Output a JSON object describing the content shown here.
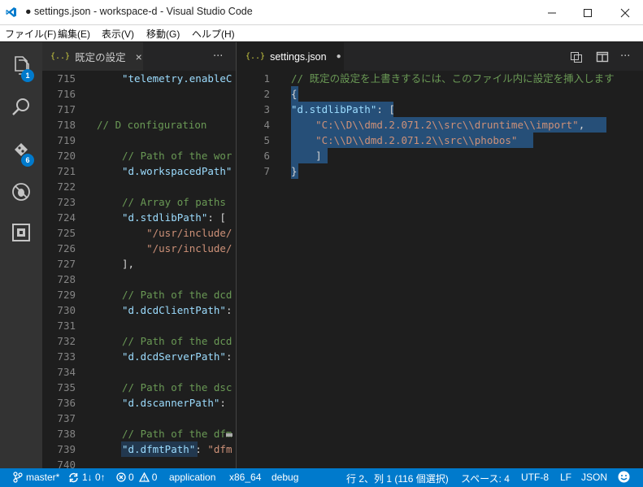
{
  "window": {
    "title": "● settings.json - workspace-d - Visual Studio Code",
    "controls": [
      "minimize-icon",
      "maximize-icon",
      "close-icon"
    ]
  },
  "menu": [
    "ファイル(F)",
    "編集(E)",
    "表示(V)",
    "移動(G)",
    "ヘルプ(H)"
  ],
  "activity": {
    "items": [
      "explorer-icon",
      "search-icon",
      "source-control-icon",
      "debug-icon",
      "extensions-icon"
    ],
    "badges": {
      "explorer": "1",
      "scm": "6"
    }
  },
  "left_editor": {
    "tab": {
      "icon": "{..}",
      "label": "既定の設定",
      "close": "×"
    },
    "more": "···",
    "lines": [
      {
        "n": "715",
        "parts": [
          [
            "k",
            "\"telemetry.enableC"
          ]
        ]
      },
      {
        "n": "716",
        "parts": []
      },
      {
        "n": "717",
        "parts": []
      },
      {
        "n": "718",
        "parts": [
          [
            "c",
            "// D configuration"
          ]
        ]
      },
      {
        "n": "719",
        "parts": []
      },
      {
        "n": "720",
        "parts": [
          [
            "c",
            "// Path of the wor"
          ]
        ]
      },
      {
        "n": "721",
        "parts": [
          [
            "k",
            "\"d.workspacedPath\""
          ]
        ]
      },
      {
        "n": "722",
        "parts": []
      },
      {
        "n": "723",
        "parts": [
          [
            "c",
            "// Array of paths "
          ]
        ]
      },
      {
        "n": "724",
        "parts": [
          [
            "k",
            "\"d.stdlibPath\""
          ],
          [
            "p",
            ": ["
          ]
        ]
      },
      {
        "n": "725",
        "parts": [
          [
            "s",
            "    \"/usr/include/"
          ]
        ]
      },
      {
        "n": "726",
        "parts": [
          [
            "s",
            "    \"/usr/include/"
          ]
        ]
      },
      {
        "n": "727",
        "parts": [
          [
            "p",
            "],"
          ]
        ]
      },
      {
        "n": "728",
        "parts": []
      },
      {
        "n": "729",
        "parts": [
          [
            "c",
            "// Path of the dcd"
          ]
        ]
      },
      {
        "n": "730",
        "parts": [
          [
            "k",
            "\"d.dcdClientPath\""
          ],
          [
            "p",
            ":"
          ]
        ]
      },
      {
        "n": "731",
        "parts": []
      },
      {
        "n": "732",
        "parts": [
          [
            "c",
            "// Path of the dcd"
          ]
        ]
      },
      {
        "n": "733",
        "parts": [
          [
            "k",
            "\"d.dcdServerPath\""
          ],
          [
            "p",
            ":"
          ]
        ]
      },
      {
        "n": "734",
        "parts": []
      },
      {
        "n": "735",
        "parts": [
          [
            "c",
            "// Path of the dsc"
          ]
        ]
      },
      {
        "n": "736",
        "parts": [
          [
            "k",
            "\"d.dscannerPath\""
          ],
          [
            "p",
            ":"
          ]
        ]
      },
      {
        "n": "737",
        "parts": []
      },
      {
        "n": "738",
        "parts": [
          [
            "c",
            "// Path of the dfm"
          ]
        ]
      },
      {
        "n": "739",
        "parts": [
          [
            "k",
            "\"d.dfmtPath\""
          ],
          [
            "p",
            ": "
          ],
          [
            "s",
            "\"dfm"
          ]
        ]
      },
      {
        "n": "740",
        "parts": []
      }
    ]
  },
  "right_editor": {
    "tab": {
      "icon": "{..}",
      "label": "settings.json",
      "dirty": "●"
    },
    "actions": [
      "open-changes-icon",
      "split-editor-icon"
    ],
    "more": "···",
    "lines": [
      {
        "n": "1",
        "parts": [
          [
            "c",
            "// 既定の設定を上書きするには、このファイル内に設定を挿入します"
          ]
        ]
      },
      {
        "n": "2",
        "parts": [
          [
            "p",
            "{"
          ]
        ]
      },
      {
        "n": "3",
        "parts": [
          [
            "k",
            "\"d.stdlibPath\""
          ],
          [
            "p",
            ": ["
          ]
        ]
      },
      {
        "n": "4",
        "parts": [
          [
            "p",
            "    "
          ],
          [
            "s",
            "\"C:\\\\D\\\\dmd.2.071.2\\\\src\\\\druntime\\\\import\""
          ],
          [
            "p",
            ","
          ]
        ]
      },
      {
        "n": "5",
        "parts": [
          [
            "p",
            "    "
          ],
          [
            "s",
            "\"C:\\\\D\\\\dmd.2.071.2\\\\src\\\\phobos\""
          ]
        ]
      },
      {
        "n": "6",
        "parts": [
          [
            "p",
            "    ]"
          ]
        ]
      },
      {
        "n": "7",
        "parts": [
          [
            "p",
            "}"
          ]
        ]
      }
    ]
  },
  "status": {
    "branch": "master*",
    "sync": "1↓ 0↑",
    "errors": "0",
    "warnings": "0",
    "config": "application",
    "arch": "x86_64",
    "build": "debug",
    "position": "行 2、列 1 (116 個選択)",
    "indent": "スペース: 4",
    "encoding": "UTF-8",
    "eol": "LF",
    "language": "JSON",
    "feedback_icon": "smiley-icon"
  },
  "colors": {
    "accent": "#007acc",
    "activity_bg": "#333333",
    "editor_bg": "#1e1e1e",
    "selection": "#264f78",
    "comment": "#6a9955",
    "key": "#9cdcfe",
    "string": "#ce9178"
  }
}
